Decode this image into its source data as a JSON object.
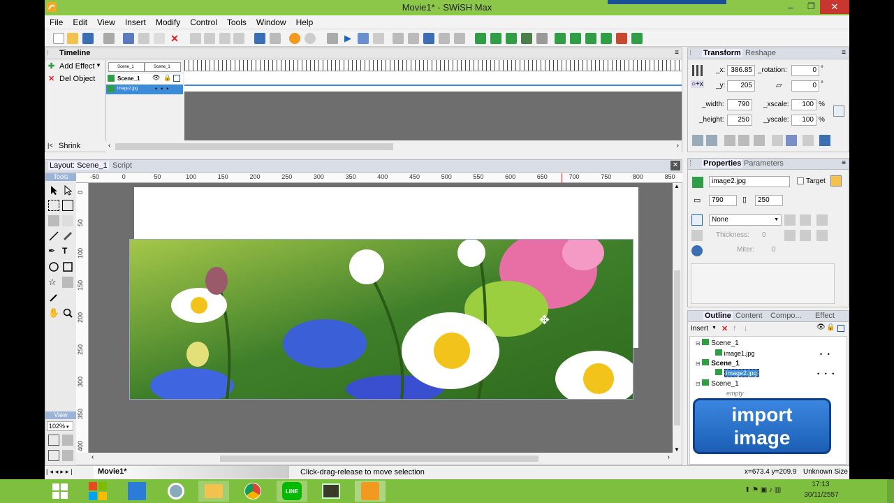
{
  "window": {
    "title": "Movie1* - SWiSH Max"
  },
  "menu": [
    "File",
    "Edit",
    "View",
    "Insert",
    "Modify",
    "Control",
    "Tools",
    "Window",
    "Help"
  ],
  "timeline": {
    "title": "Timeline",
    "add_effect": "Add Effect",
    "del_object": "Del Object",
    "shrink": "Shrink",
    "scene_tab_1": "Scene_1",
    "scene_tab_2": "Scene_1",
    "row_scene": "Scene_1",
    "row_item": "image2.jpg"
  },
  "layout": {
    "tab_layout": "Layout: Scene_1",
    "tab_script": "Script",
    "tools_label": "Tools",
    "view_label": "View",
    "zoom": "102%",
    "hruler": [
      "-50",
      "0",
      "50",
      "100",
      "150",
      "200",
      "250",
      "300",
      "350",
      "400",
      "450",
      "500",
      "550",
      "600",
      "650",
      "700",
      "750",
      "800",
      "850"
    ],
    "vruler": [
      "0",
      "50",
      "100",
      "150",
      "200",
      "250",
      "300",
      "350",
      "400"
    ]
  },
  "transform": {
    "tab_transform": "Transform",
    "tab_reshape": "Reshape",
    "x_label": "_x:",
    "x": "386.85",
    "y_label": "_y:",
    "y": "205",
    "rotation_label": "_rotation:",
    "rotation": "0",
    "skew": "0",
    "deg": "°",
    "width_label": "_width:",
    "width": "790",
    "height_label": "_height:",
    "height": "250",
    "xscale_label": "_xscale:",
    "xscale": "100",
    "yscale_label": "_yscale:",
    "yscale": "100",
    "pct": "%"
  },
  "properties": {
    "tab_properties": "Properties",
    "tab_parameters": "Parameters",
    "name": "image2.jpg",
    "target": "Target",
    "w": "790",
    "h": "250",
    "line_style": "None",
    "thickness_label": "Thickness:",
    "thickness": "0",
    "miter_label": "Miter:",
    "miter": "0"
  },
  "outline": {
    "tabs": [
      "Outline",
      "Content",
      "Compo...",
      "Effect"
    ],
    "insert": "Insert",
    "items": [
      {
        "label": "Scene_1",
        "level": 0,
        "bold": false
      },
      {
        "label": "image1.jpg",
        "level": 1,
        "bold": false
      },
      {
        "label": "Scene_1",
        "level": 0,
        "bold": true
      },
      {
        "label": "image2.jpg",
        "level": 1,
        "bold": false,
        "selected": true
      },
      {
        "label": "Scene_1",
        "level": 0,
        "bold": false
      },
      {
        "label": "empty",
        "level": 1,
        "bold": false,
        "italic": true
      }
    ],
    "import_button": "import\nimage"
  },
  "status": {
    "movie_tab": "Movie1*",
    "message": "Click-drag-release to move selection",
    "coords": "x=673.4 y=209.9",
    "size": "Unknown Size"
  },
  "taskbar": {
    "time": "17:13",
    "date": "30/11/2557"
  },
  "colors": {
    "title_bar": "#8cc74a",
    "taskbar": "#7fbf3f",
    "import_button": "#1c5fb5",
    "stage_bg": "#6e6e6e"
  }
}
